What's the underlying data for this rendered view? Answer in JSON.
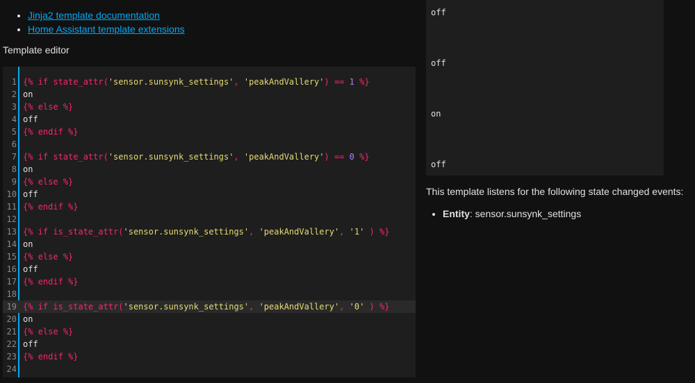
{
  "links": [
    {
      "label": "Jinja2 template documentation"
    },
    {
      "label": "Home Assistant template extensions"
    }
  ],
  "editor_label": "Template editor",
  "code": [
    "{% if state_attr('sensor.sunsynk_settings', 'peakAndVallery') == 1 %}",
    "on",
    "{% else %}",
    "off",
    "{% endif %}",
    "",
    "{% if state_attr('sensor.sunsynk_settings', 'peakAndVallery') == 0 %}",
    "on",
    "{% else %}",
    "off",
    "{% endif %}",
    "",
    "{% if is_state_attr('sensor.sunsynk_settings', 'peakAndVallery', '1' ) %}",
    "on",
    "{% else %}",
    "off",
    "{% endif %}",
    "",
    "{% if is_state_attr('sensor.sunsynk_settings', 'peakAndVallery', '0' ) %}",
    "on",
    "{% else %}",
    "off",
    "{% endif %}",
    ""
  ],
  "active_line": 19,
  "result_lines": [
    "off",
    "off",
    "on",
    "off"
  ],
  "listen_text": "This template listens for the following state changed events:",
  "listen_entity_label": "Entity",
  "listen_entity_value": ": sensor.sunsynk_settings",
  "colors": {
    "accent": "#03a9f4",
    "keyword": "#f9266e",
    "string": "#e6db74",
    "number": "#ae81ff"
  }
}
